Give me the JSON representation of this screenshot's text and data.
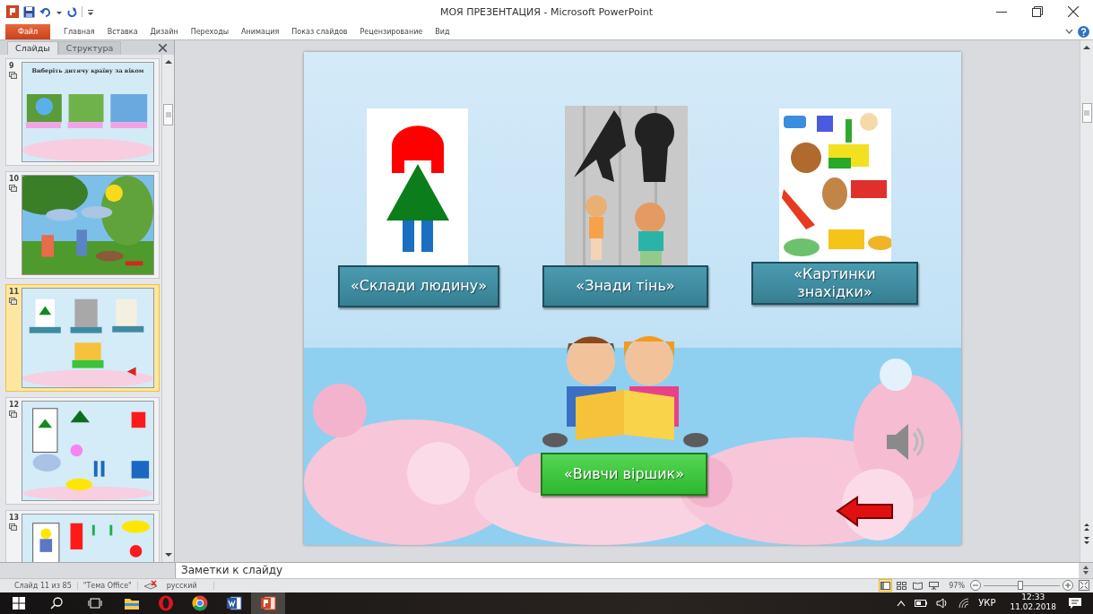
{
  "window": {
    "title": "МОЯ ПРЕЗЕНТАЦИЯ  -  Microsoft PowerPoint"
  },
  "ribbon_tabs": [
    {
      "label": "Файл",
      "kind": "file"
    },
    {
      "label": "Главная",
      "kind": "tab"
    },
    {
      "label": "Вставка",
      "kind": "tab"
    },
    {
      "label": "Дизайн",
      "kind": "tab"
    },
    {
      "label": "Переходы",
      "kind": "tab"
    },
    {
      "label": "Анимация",
      "kind": "tab"
    },
    {
      "label": "Показ слайдов",
      "kind": "tab"
    },
    {
      "label": "Рецензирование",
      "kind": "tab"
    },
    {
      "label": "Вид",
      "kind": "tab"
    }
  ],
  "panel": {
    "tabs": [
      {
        "label": "Слайды",
        "selected": true
      },
      {
        "label": "Структура",
        "selected": false
      }
    ],
    "thumbnails": [
      {
        "number": "9",
        "selected": false,
        "kind": "title-cards",
        "title": "Виберіть дитячу країну за віком"
      },
      {
        "number": "10",
        "selected": false,
        "kind": "scene"
      },
      {
        "number": "11",
        "selected": true,
        "kind": "menu"
      },
      {
        "number": "12",
        "selected": false,
        "kind": "shapes"
      },
      {
        "number": "13",
        "selected": false,
        "kind": "figure"
      }
    ]
  },
  "slide": {
    "cards": [
      {
        "label": "«Склади людину»",
        "kind": "figure"
      },
      {
        "label": "«Знади тінь»",
        "kind": "shadows"
      },
      {
        "label": "«Картинки знахідки»",
        "kind": "toys"
      }
    ],
    "poem_button": {
      "label": "«Вивчи віршик»"
    }
  },
  "notes": {
    "placeholder": "Заметки к слайду"
  },
  "status_bar": {
    "slide": "Слайд 11 из 85",
    "theme": "\"Тема Office\"",
    "language": "русский",
    "views": [
      {
        "kind": "normal",
        "selected": true
      },
      {
        "kind": "sorter",
        "selected": false
      },
      {
        "kind": "reading",
        "selected": false
      },
      {
        "kind": "show",
        "selected": false
      }
    ],
    "zoom": "97%",
    "zoom_slider": {
      "level": 0.48
    }
  },
  "taskbar": {
    "apps": [
      {
        "kind": "explorer",
        "selected": false
      },
      {
        "kind": "opera",
        "selected": false
      },
      {
        "kind": "chrome",
        "selected": false
      },
      {
        "kind": "word",
        "selected": false
      },
      {
        "kind": "powerpoint",
        "selected": true
      }
    ],
    "language": "УКР",
    "time": "12:33",
    "date": "11.02.2018"
  }
}
